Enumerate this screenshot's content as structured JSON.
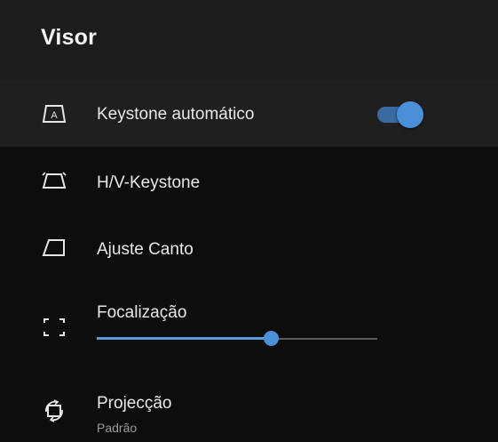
{
  "header": {
    "title": "Visor"
  },
  "items": [
    {
      "label": "Keystone automático",
      "icon": "auto-keystone-icon",
      "toggle_on": true
    },
    {
      "label": "H/V-Keystone",
      "icon": "keystone-trapezoid-icon"
    },
    {
      "label": "Ajuste Canto",
      "icon": "corner-adjust-icon"
    },
    {
      "label": "Focalização",
      "icon": "focus-frame-icon",
      "slider_value": 0.62
    },
    {
      "label": "Projecção",
      "sublabel": "Padrão",
      "icon": "projection-rotate-icon"
    }
  ],
  "colors": {
    "accent": "#4a90d9",
    "background": "#0d0d0d",
    "header_bg": "#1c1c1c",
    "selected_bg": "#1f1f1f"
  }
}
